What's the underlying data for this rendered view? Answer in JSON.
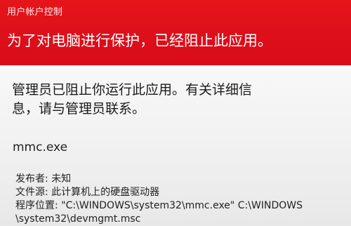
{
  "window": {
    "title": "用户帐户控制",
    "headline": "为了对电脑进行保护，已经阻止此应用。",
    "accent_color": "#e0121b"
  },
  "message": {
    "line1": "管理员已阻止你运行此应用。有关详细信",
    "line2": "息，请与管理员联系。"
  },
  "app": {
    "name": "mmc.exe"
  },
  "details": {
    "publisher_label": "发布者:",
    "publisher_value": "未知",
    "source_label": "文件源:",
    "source_value": "此计算机上的硬盘驱动器",
    "location_label": "程序位置:",
    "location_value_line1": "\"C:\\WINDOWS\\system32\\mmc.exe\" C:\\WINDOWS",
    "location_value_line2": "\\system32\\devmgmt.msc"
  }
}
